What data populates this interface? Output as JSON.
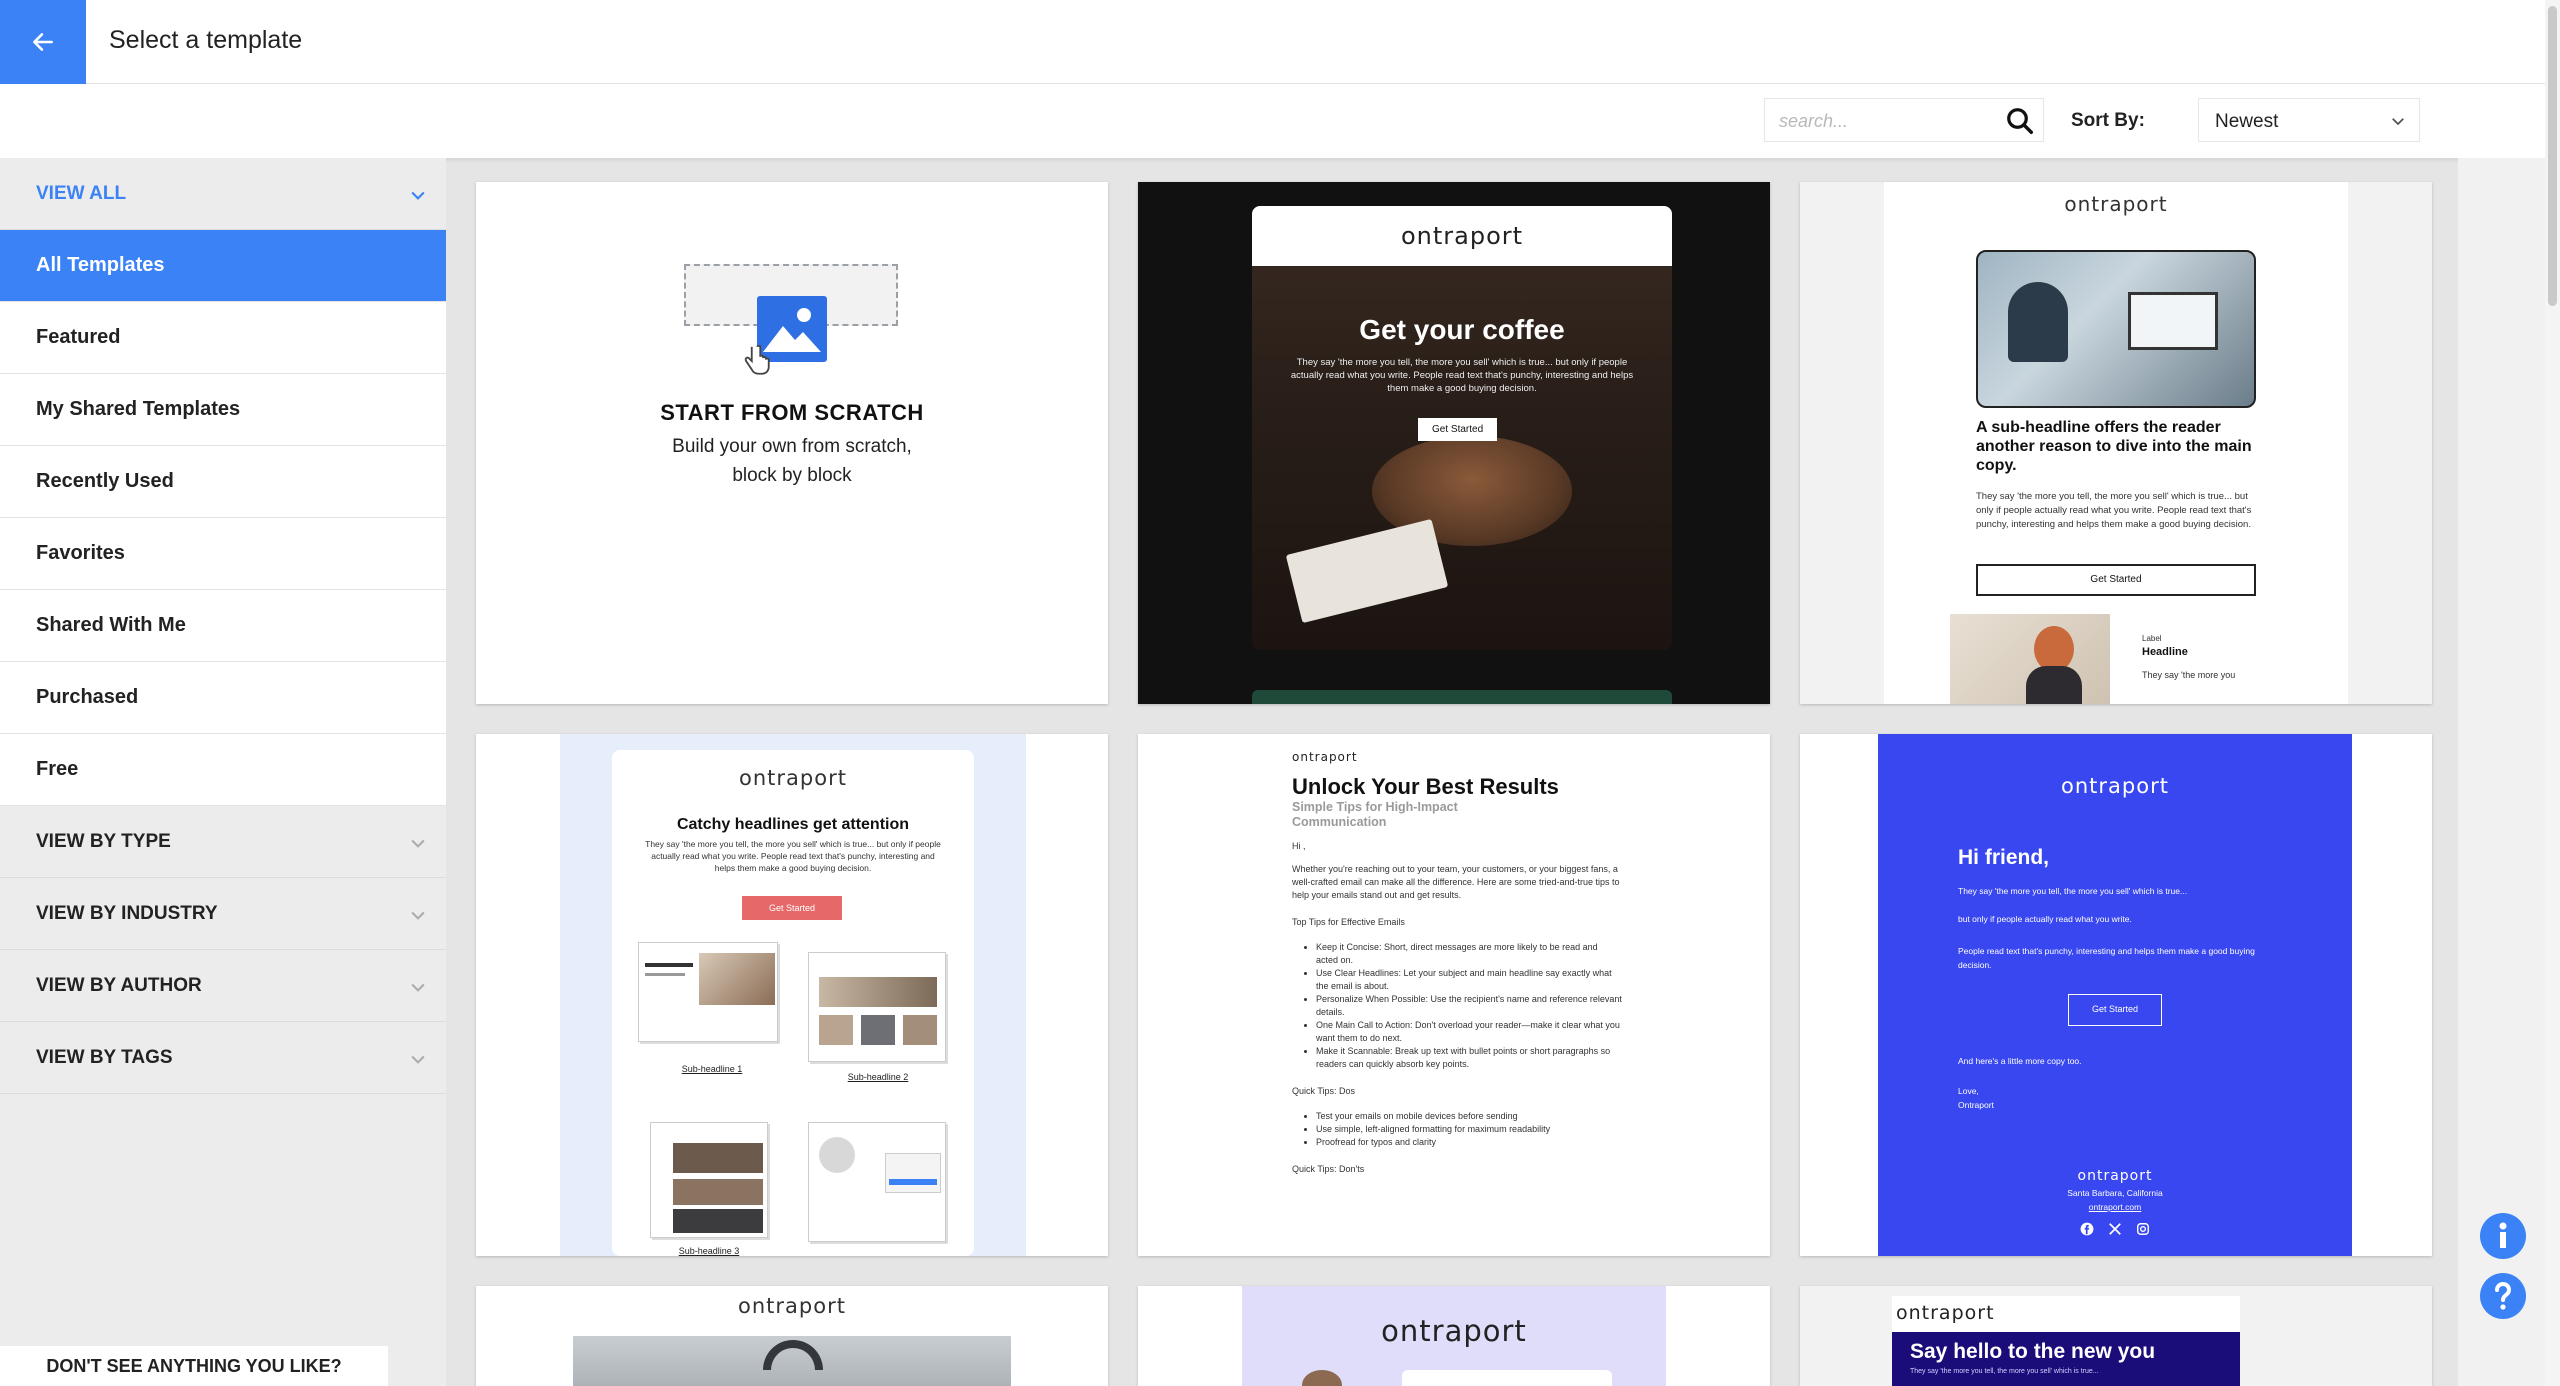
{
  "header": {
    "title": "Select a template"
  },
  "toolbar": {
    "search_placeholder": "search...",
    "sort_label": "Sort By:",
    "sort_value": "Newest"
  },
  "sidebar": {
    "view_all": "VIEW ALL",
    "items": [
      "All Templates",
      "Featured",
      "My Shared Templates",
      "Recently Used",
      "Favorites",
      "Shared With Me",
      "Purchased",
      "Free"
    ],
    "groups": [
      "VIEW BY TYPE",
      "VIEW BY INDUSTRY",
      "VIEW BY AUTHOR",
      "VIEW BY TAGS"
    ],
    "footer": "DON'T SEE ANYTHING YOU LIKE?"
  },
  "cards": {
    "scratch": {
      "title": "START FROM SCRATCH",
      "line1": "Build your own from scratch,",
      "line2": "block by block"
    },
    "coffee": {
      "logo": "ontraport",
      "headline": "Get your coffee",
      "body": "They say 'the more you tell, the more you sell' which is true... but only if people actually read what you write. People read text that's punchy, interesting and helps them make a good buying decision.",
      "button": "Get Started"
    },
    "office": {
      "logo": "ontraport",
      "headline": "A sub-headline offers the reader another reason to dive into the main copy.",
      "body": "They say 'the more you tell, the more you sell' which is true... but only if people actually read what you write. People read text that's punchy, interesting and helps them make a good buying decision.",
      "button": "Get Started",
      "label": "Label",
      "sub_headline": "Headline",
      "sub_body": "They say 'the more you"
    },
    "catchy": {
      "logo": "ontraport",
      "headline": "Catchy headlines get attention",
      "body": "They say 'the more you tell, the more you sell' which is true... but only if people actually read what you write. People read text that's punchy, interesting and helps them make a good buying decision.",
      "button": "Get Started",
      "sub1": "Sub-headline 1",
      "sub2": "Sub-headline 2",
      "sub3": "Sub-headline 3"
    },
    "unlock": {
      "logo": "ontraport",
      "headline": "Unlock Your Best Results",
      "subhead": "Simple Tips for High-Impact Communication",
      "greet": "Hi ,",
      "intro": "Whether you're reaching out to your team, your customers, or your biggest fans, a well-crafted email can make all the difference. Here are some tried-and-true tips to help your emails stand out and get results.",
      "tips_title": "Top Tips for Effective Emails",
      "tips": [
        "Keep it Concise: Short, direct messages are more likely to be read and acted on.",
        "Use Clear Headlines: Let your subject and main headline say exactly what the email is about.",
        "Personalize When Possible: Use the recipient's name and reference relevant details.",
        "One Main Call to Action: Don't overload your reader—make it clear what you want them to do next.",
        "Make it Scannable: Break up text with bullet points or short paragraphs so readers can quickly absorb key points."
      ],
      "dos_title": "Quick Tips: Dos",
      "dos": [
        "Test your emails on mobile devices before sending",
        "Use simple, left-aligned formatting for maximum readability",
        "Proofread for typos and clarity"
      ],
      "donts_title": "Quick Tips: Don'ts"
    },
    "friend": {
      "logo": "ontraport",
      "headline": "Hi friend,",
      "p1": "They say 'the more you tell, the more you sell' which is true...",
      "p2": "but only if people actually read what you write.",
      "p3": "People read text that's punchy, interesting and helps them make a good buying decision.",
      "button": "Get Started",
      "p4": "And here's a little more copy too.",
      "sign1": "Love,",
      "sign2": "Ontraport",
      "footer_logo": "ontraport",
      "address": "Santa Barbara, California",
      "site": "ontraport.com"
    },
    "row3a": {
      "logo": "ontraport"
    },
    "row3b": {
      "logo": "ontraport"
    },
    "row3c": {
      "logo": "ontraport",
      "headline": "Say hello to the new you",
      "body": "They say 'the more you tell, the more you sell' which is true..."
    }
  },
  "colors": {
    "accent": "#3b82f6",
    "royal": "#3847f0",
    "coral": "#e66868"
  }
}
